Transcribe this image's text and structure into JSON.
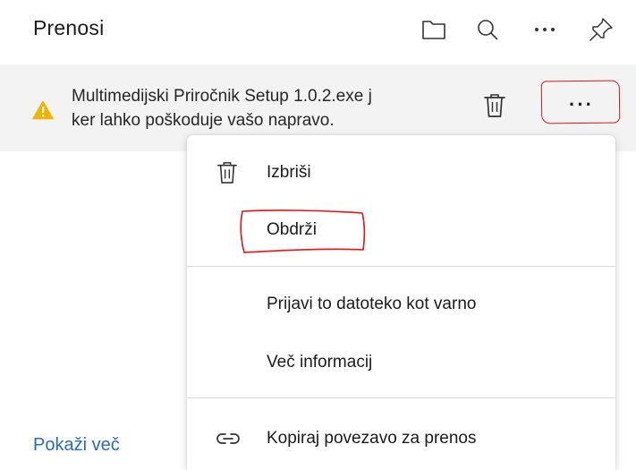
{
  "header": {
    "title": "Prenosi",
    "icons": [
      "folder-icon",
      "search-icon",
      "more-icon",
      "pin-icon"
    ]
  },
  "download_item": {
    "line1": "Multimedijski Priročnik Setup 1.0.2.exe j",
    "line2": "ker lahko poškoduje vašo napravo.",
    "status_icon": "warning-icon",
    "warning_color": "#f0b400",
    "more_label": "···"
  },
  "menu": {
    "items": [
      {
        "label": "Izbriši",
        "icon": "trash-icon"
      },
      {
        "label": "Obdrži",
        "icon": ""
      },
      {
        "label": "Prijavi to datoteko kot varno",
        "icon": ""
      },
      {
        "label": "Več informacij",
        "icon": ""
      },
      {
        "label": "Kopiraj povezavo za prenos",
        "icon": "link-icon"
      }
    ]
  },
  "footer": {
    "show_more": "Pokaži več",
    "link_color": "#2b6cb0"
  },
  "annotation_color": "#e0141e"
}
